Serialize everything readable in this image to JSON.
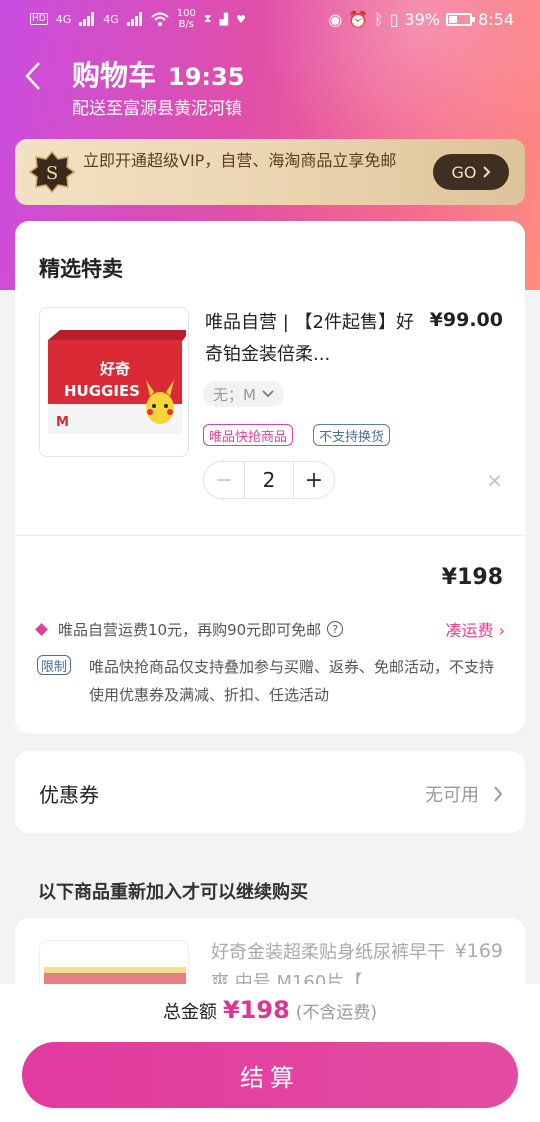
{
  "status_bar": {
    "network_label": "4G",
    "network_label_2": "4G",
    "net_speed_value": "100",
    "net_speed_unit": "B/s",
    "battery": "39%",
    "time": "8:54"
  },
  "header": {
    "title": "购物车",
    "time": "19:35",
    "delivery": "配送至富源县黄泥河镇"
  },
  "vip_banner": {
    "badge_letter": "S",
    "text": "立即开通超级VIP，自营、海淘商品立享免邮",
    "go_label": "GO"
  },
  "special_section": {
    "title": "精选特卖",
    "product": {
      "name": "唯品自营 | 【2件起售】好奇铂金装倍柔...",
      "price": "¥99.00",
      "spec": "无；M",
      "tags": [
        "唯品快抢商品",
        "不支持换货"
      ],
      "quantity": "2",
      "brand_text": "HUGGIES",
      "brand_cn": "好奇",
      "size_mark": "M"
    },
    "subtotal": "¥198",
    "shipping_text": "唯品自营运费10元，再购90元即可免邮",
    "shipping_link": "凑运费",
    "limit_tag": "限制",
    "limit_text": "唯品快抢商品仅支持叠加参与买赠、返券、免邮活动，不支持使用优惠券及满减、折扣、任选活动"
  },
  "coupon": {
    "label": "优惠券",
    "value": "无可用"
  },
  "re_add_section": {
    "title": "以下商品重新加入才可以继续购买",
    "product": {
      "name": "好奇金装超柔贴身纸尿裤早干爽 中号 M160片【",
      "price": "¥169"
    }
  },
  "footer": {
    "total_label": "总金额",
    "total_amount": "¥198",
    "total_note": "(不含运费)",
    "checkout_label": "结算"
  },
  "colors": {
    "accent": "#e0358f",
    "hero_start": "#c94de0",
    "hero_end": "#ff8c80",
    "go_button": "#3e2f22"
  }
}
